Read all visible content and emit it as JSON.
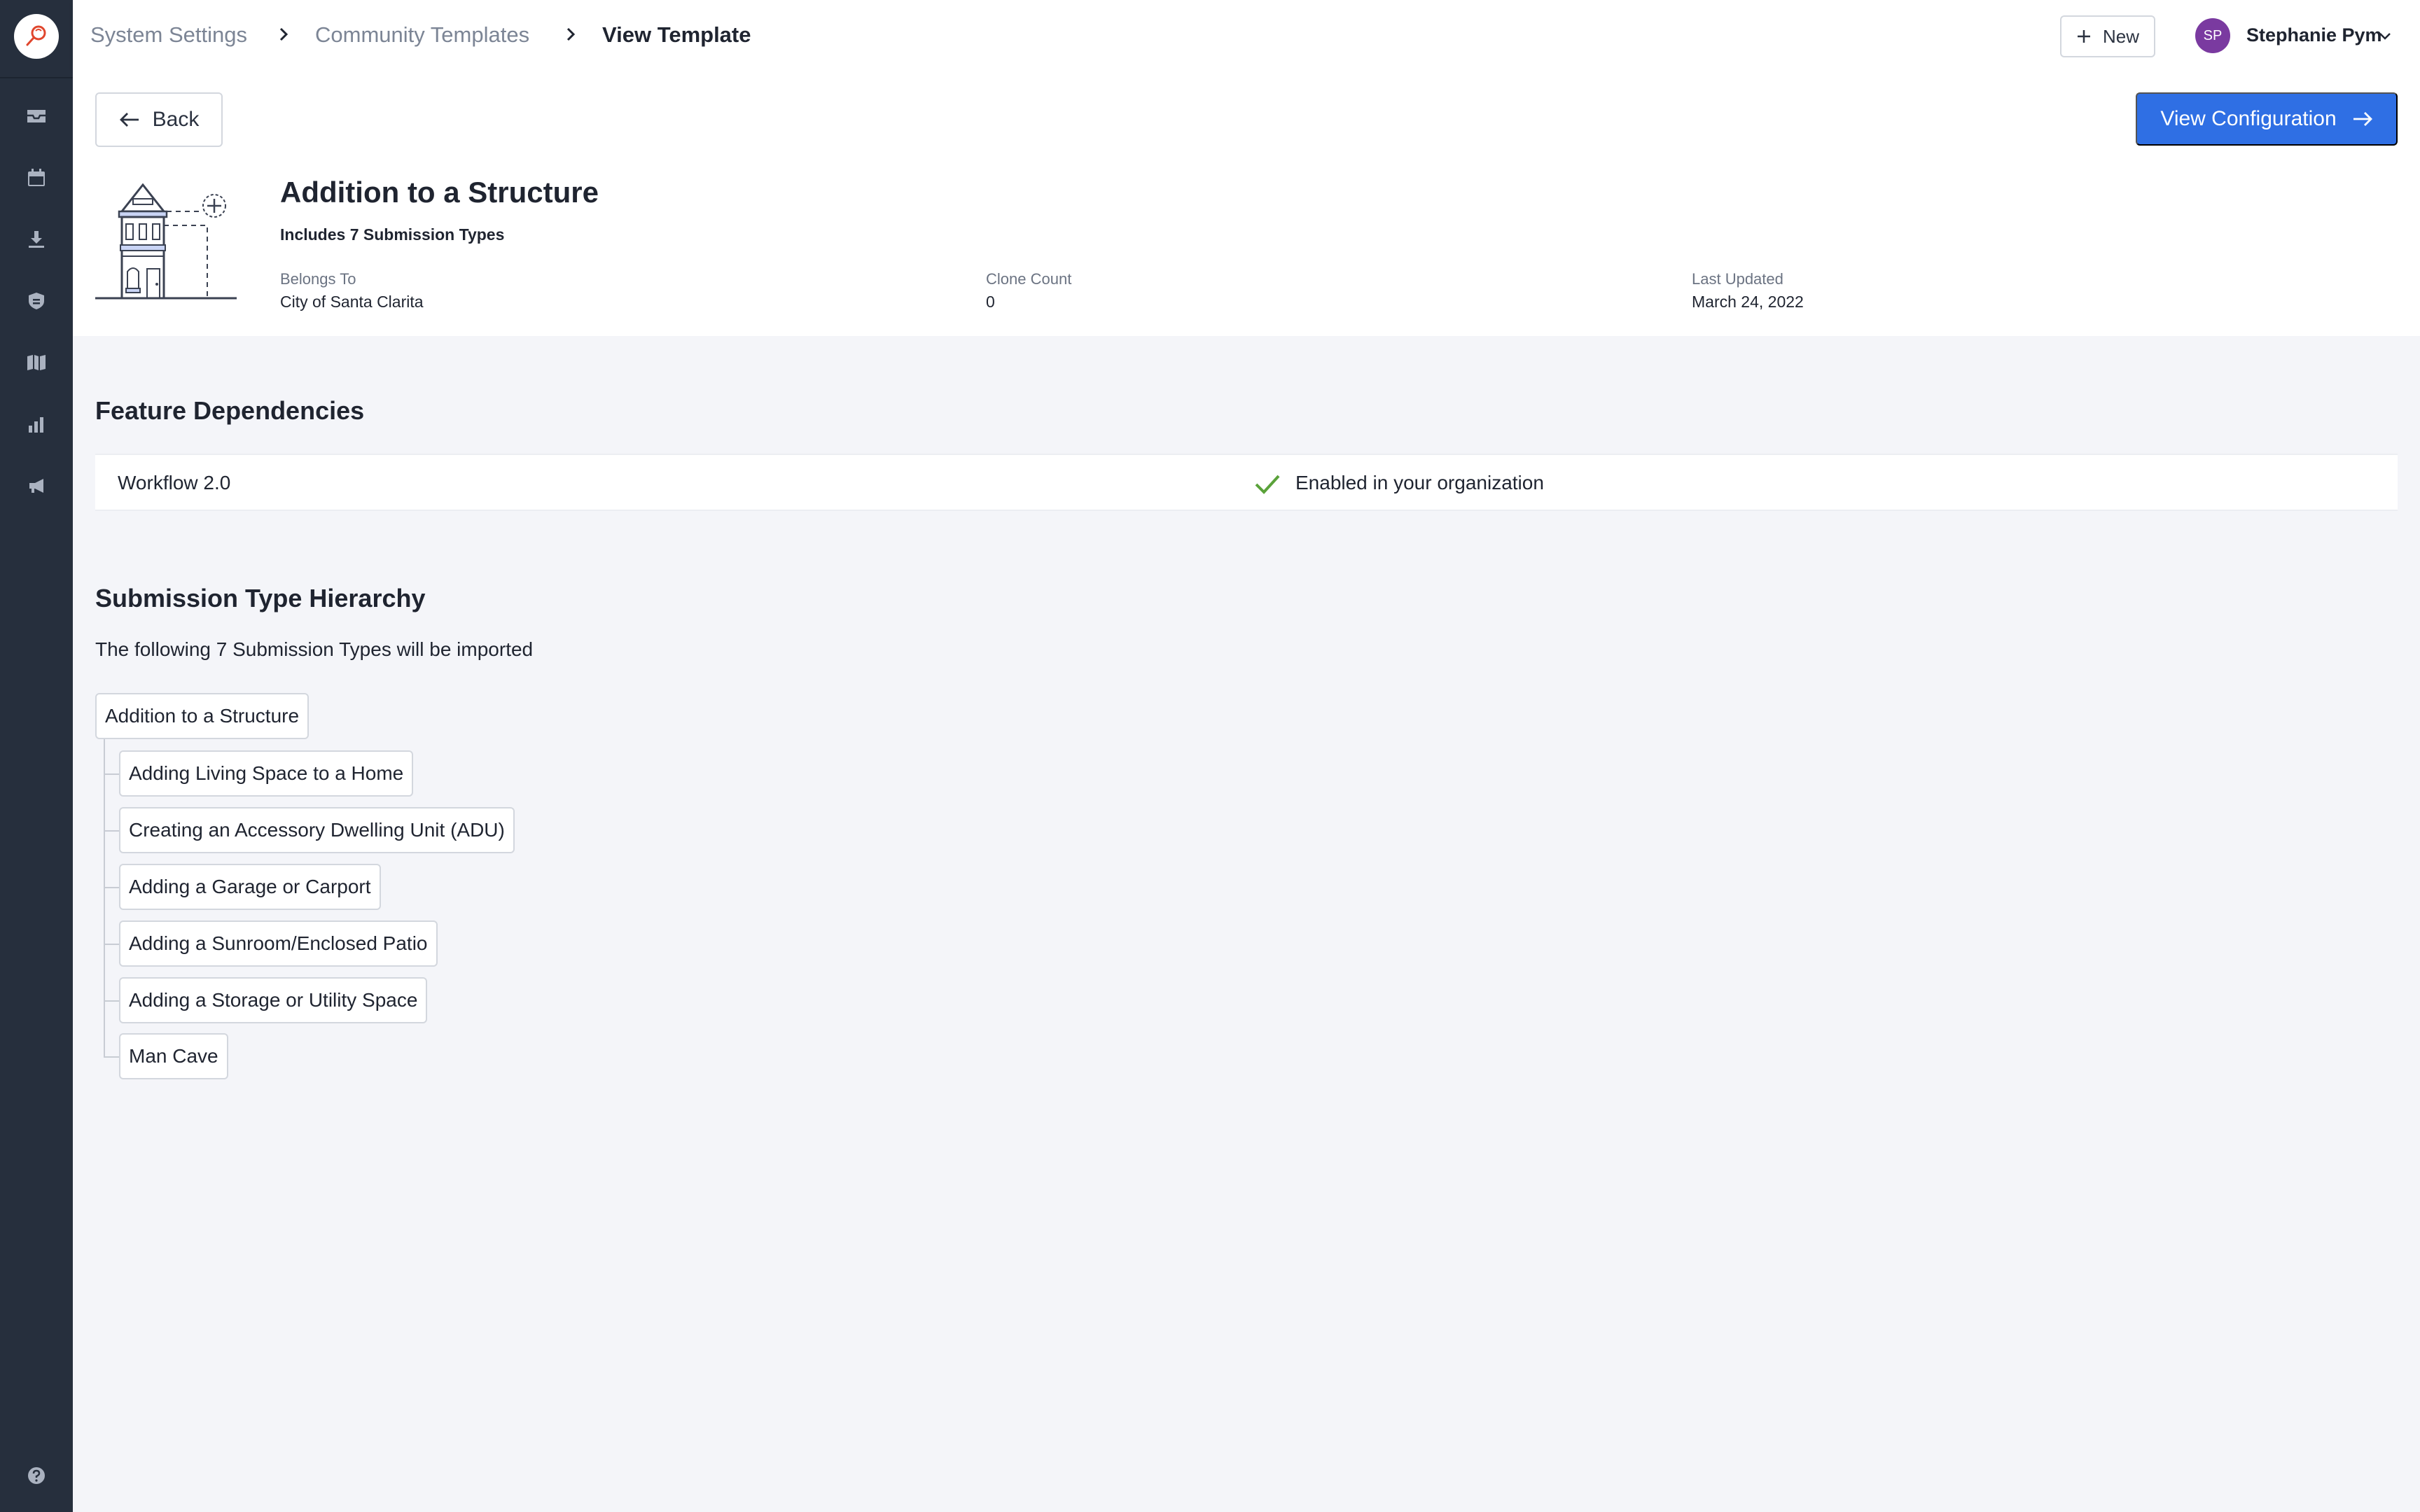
{
  "breadcrumbs": [
    {
      "label": "System Settings"
    },
    {
      "label": "Community Templates"
    },
    {
      "label": "View Template"
    }
  ],
  "topbar": {
    "new_label": "New",
    "user_initials": "SP",
    "user_name": "Stephanie Pym"
  },
  "sidebar": {
    "items": [
      {
        "icon": "inbox-icon"
      },
      {
        "icon": "calendar-icon"
      },
      {
        "icon": "download-icon"
      },
      {
        "icon": "shield-icon"
      },
      {
        "icon": "map-icon"
      },
      {
        "icon": "bar-chart-icon"
      },
      {
        "icon": "megaphone-icon"
      }
    ],
    "help_icon": "help-icon"
  },
  "actions": {
    "back_label": "Back",
    "view_config_label": "View Configuration"
  },
  "template": {
    "title": "Addition to a Structure",
    "subtitle": "Includes 7 Submission Types",
    "belongs_to_label": "Belongs To",
    "belongs_to_value": "City of Santa Clarita",
    "clone_count_label": "Clone Count",
    "clone_count_value": "0",
    "last_updated_label": "Last Updated",
    "last_updated_value": "March 24, 2022"
  },
  "dependencies": {
    "title": "Feature Dependencies",
    "items": [
      {
        "name": "Workflow 2.0",
        "status": "Enabled in your organization"
      }
    ]
  },
  "hierarchy": {
    "title": "Submission Type Hierarchy",
    "description": "The following 7 Submission Types will be imported",
    "root": "Addition to a Structure",
    "children": [
      "Adding Living Space to a Home",
      "Creating an Accessory Dwelling Unit (ADU)",
      "Adding a Garage or Carport",
      "Adding a Sunroom/Enclosed Patio",
      "Adding a Storage or Utility Space",
      "Man Cave"
    ]
  },
  "colors": {
    "sidebar": "#262f3d",
    "primary": "#2f6fe4",
    "success": "#5aa23a",
    "avatar": "#7a3aa0"
  }
}
